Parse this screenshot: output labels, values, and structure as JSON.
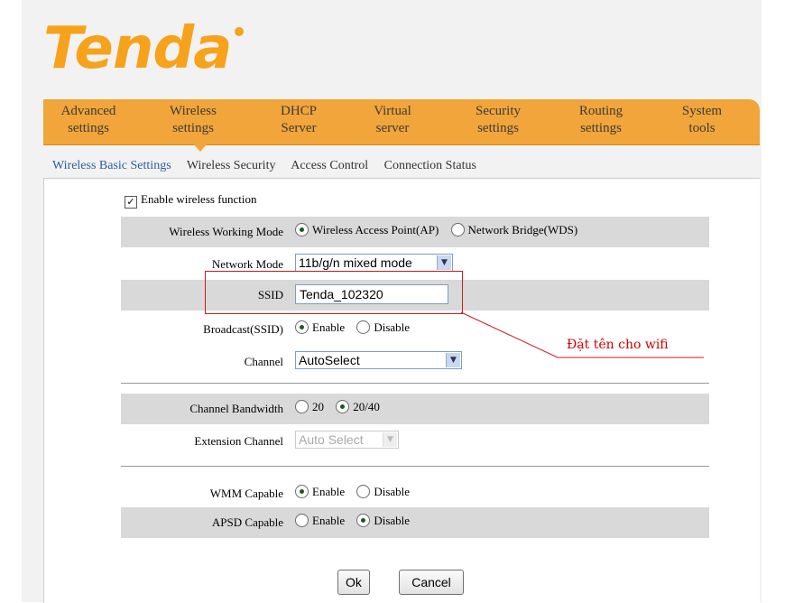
{
  "brand": {
    "logo_text": "Tenda"
  },
  "nav": {
    "items": [
      {
        "line1": "Advanced",
        "line2": "settings"
      },
      {
        "line1": "Wireless",
        "line2": "settings"
      },
      {
        "line1": "DHCP",
        "line2": "Server"
      },
      {
        "line1": "Virtual",
        "line2": "server"
      },
      {
        "line1": "Security",
        "line2": "settings"
      },
      {
        "line1": "Routing",
        "line2": "settings"
      },
      {
        "line1": "System",
        "line2": "tools"
      }
    ],
    "active_index": 1
  },
  "subnav": {
    "items": [
      "Wireless Basic Settings",
      "Wireless Security",
      "Access Control",
      "Connection Status"
    ],
    "active_index": 0
  },
  "form": {
    "enable_wireless": {
      "label": "Enable wireless function",
      "checked": true,
      "mark": "✓"
    },
    "working_mode": {
      "label": "Wireless Working Mode",
      "options": [
        "Wireless Access Point(AP)",
        "Network Bridge(WDS)"
      ],
      "selected": 0
    },
    "network_mode": {
      "label": "Network Mode",
      "value": "11b/g/n mixed mode"
    },
    "ssid": {
      "label": "SSID",
      "value": "Tenda_102320"
    },
    "broadcast": {
      "label": "Broadcast(SSID)",
      "options": [
        "Enable",
        "Disable"
      ],
      "selected": 0
    },
    "channel": {
      "label": "Channel",
      "value": "AutoSelect"
    },
    "bandwidth": {
      "label": "Channel Bandwidth",
      "options": [
        "20",
        "20/40"
      ],
      "selected": 1
    },
    "extension_channel": {
      "label": "Extension Channel",
      "value": "Auto Select",
      "disabled": true
    },
    "wmm": {
      "label": "WMM Capable",
      "options": [
        "Enable",
        "Disable"
      ],
      "selected": 0
    },
    "apsd": {
      "label": "APSD Capable",
      "options": [
        "Enable",
        "Disable"
      ],
      "selected": 1
    }
  },
  "buttons": {
    "ok": "Ok",
    "cancel": "Cancel"
  },
  "annotation": {
    "text": "Đặt tên cho wifi",
    "color": "#cc0000"
  },
  "colors": {
    "nav_bg": "#f2a53a",
    "logo": "#f7a21b",
    "row_shade": "#d9d9d9"
  },
  "icons": {
    "dropdown": "chevron-down-icon"
  }
}
